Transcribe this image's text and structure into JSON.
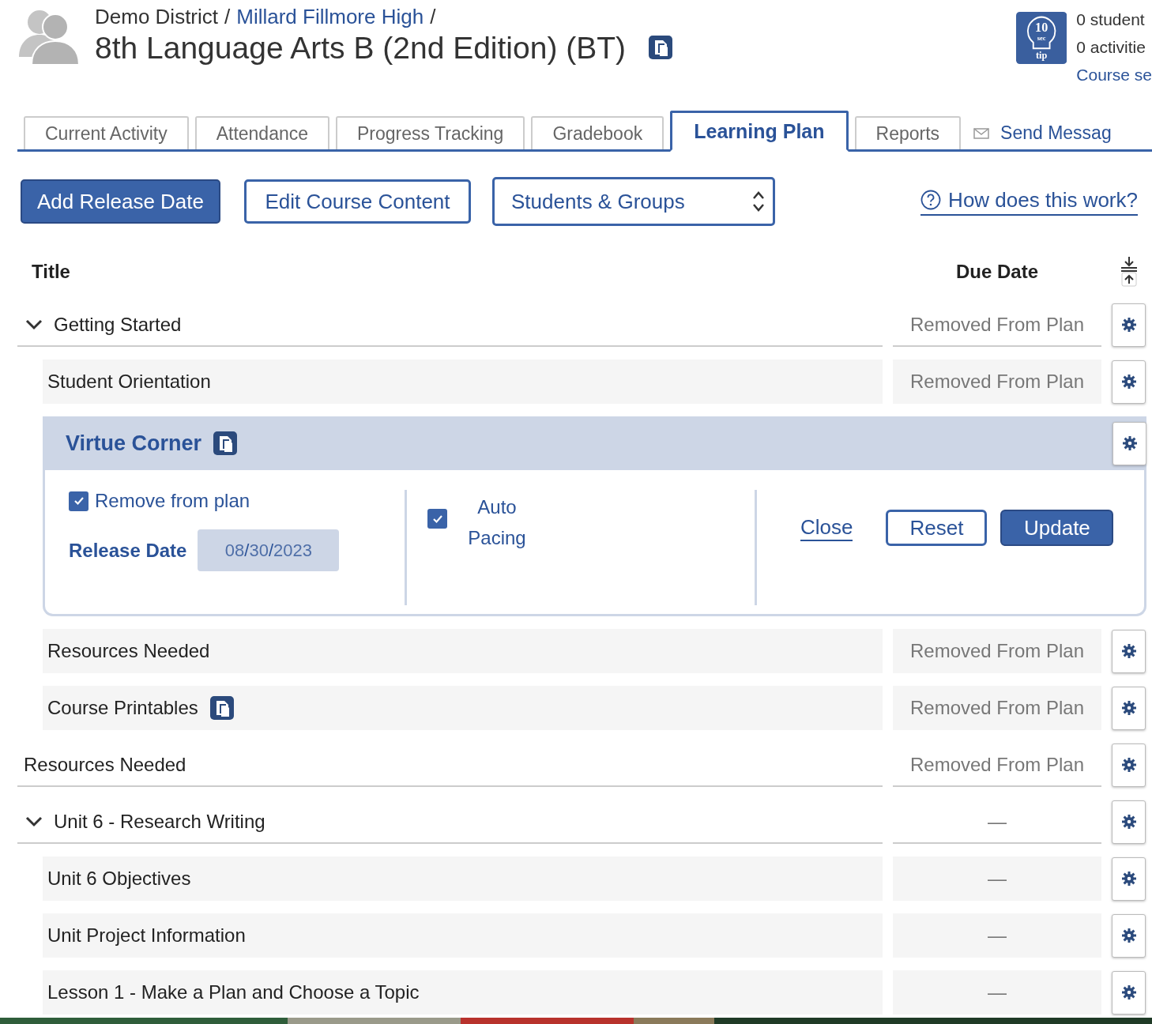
{
  "header": {
    "breadcrumb": [
      {
        "text": "Demo District",
        "link": false
      },
      {
        "text": "Millard Fillmore High",
        "link": true
      }
    ],
    "separator": "/",
    "course_title": "8th Language Arts B (2nd Edition) (BT)"
  },
  "tip": {
    "number": "10",
    "unit": "sec",
    "label": "tip"
  },
  "stats": [
    {
      "text": "0 student",
      "kind": "text"
    },
    {
      "text": "0 activitie",
      "kind": "text"
    },
    {
      "text": "Course se",
      "kind": "link"
    }
  ],
  "tabs": [
    {
      "label": "Current Activity",
      "selected": false
    },
    {
      "label": "Attendance",
      "selected": false
    },
    {
      "label": "Progress Tracking",
      "selected": false
    },
    {
      "label": "Gradebook",
      "selected": false
    },
    {
      "label": "Learning Plan",
      "selected": true
    },
    {
      "label": "Reports",
      "selected": false
    }
  ],
  "send_message": "Send Messag",
  "toolbar": {
    "add_button": "Add Release Date",
    "edit_button": "Edit Course Content",
    "group_select": "Students & Groups",
    "help_link": "How does this work?"
  },
  "columns": {
    "title": "Title",
    "due_date": "Due Date"
  },
  "rows": [
    {
      "kind": "section",
      "title": "Getting Started",
      "expanded": true,
      "due": "Removed From Plan",
      "children": [
        {
          "kind": "activity",
          "title": "Student Orientation",
          "linked": false,
          "due": "Removed From Plan"
        },
        {
          "kind": "editing",
          "title": "Virtue Corner",
          "linked": true,
          "editor": {
            "remove": {
              "label": "Remove from plan",
              "checked": true
            },
            "release": {
              "label": "Release Date",
              "month": "08",
              "day": "30",
              "year": "2023",
              "separator": "/",
              "disabled": true
            },
            "auto_pacing": {
              "label": "Auto Pacing",
              "checked": true
            },
            "close": "Close",
            "reset": "Reset",
            "update": "Update"
          }
        },
        {
          "kind": "activity",
          "title": "Resources Needed",
          "linked": false,
          "due": "Removed From Plan"
        },
        {
          "kind": "activity",
          "title": "Course Printables",
          "linked": true,
          "due": "Removed From Plan"
        }
      ]
    },
    {
      "kind": "activity",
      "title": "Resources Needed",
      "linked": false,
      "due": "Removed From Plan"
    },
    {
      "kind": "section",
      "title": "Unit 6 - Research Writing",
      "expanded": true,
      "due": "—",
      "children": [
        {
          "kind": "activity",
          "title": "Unit 6 Objectives",
          "linked": false,
          "due": "—"
        },
        {
          "kind": "activity",
          "title": "Unit Project Information",
          "linked": false,
          "due": "—"
        },
        {
          "kind": "activity",
          "title": "Lesson 1 - Make a Plan and Choose a Topic",
          "linked": false,
          "due": "—"
        }
      ]
    }
  ]
}
